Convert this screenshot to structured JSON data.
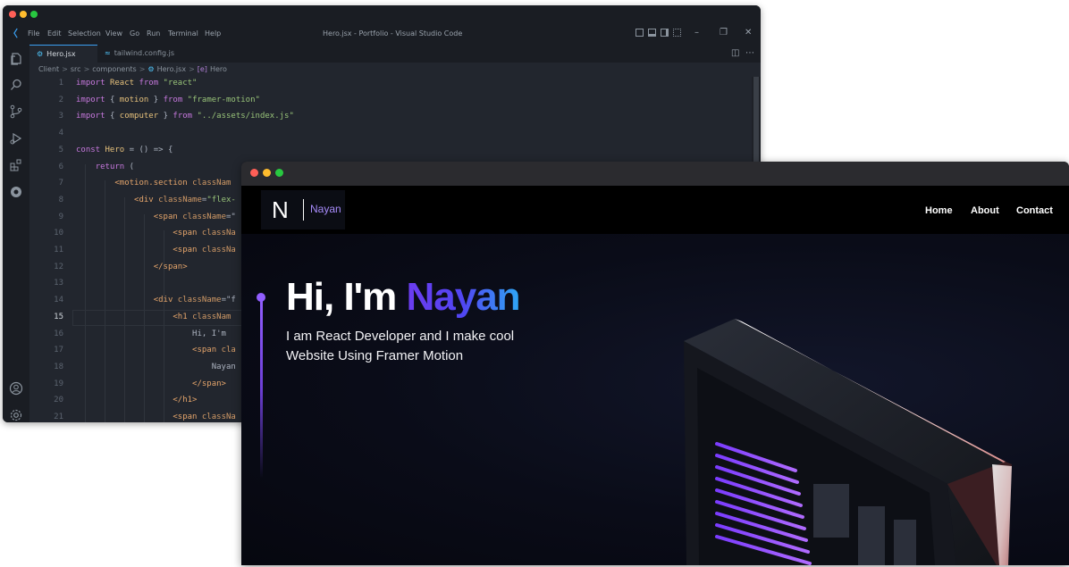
{
  "vscode": {
    "menu": [
      "File",
      "Edit",
      "Selection",
      "View",
      "Go",
      "Run",
      "Terminal",
      "Help"
    ],
    "window_title": "Hero.jsx - Portfolio - Visual Studio Code",
    "tabs": [
      {
        "label": "Hero.jsx",
        "active": true
      },
      {
        "label": "tailwind.config.js",
        "active": false
      }
    ],
    "breadcrumb": [
      "Client",
      "src",
      "components",
      "Hero.jsx",
      "Hero"
    ],
    "current_line": 15,
    "lines": [
      {
        "n": "1",
        "code": [
          [
            "kw",
            "import "
          ],
          [
            "var",
            "React "
          ],
          [
            "kw",
            "from "
          ],
          [
            "str",
            "\"react\""
          ]
        ]
      },
      {
        "n": "2",
        "code": [
          [
            "kw",
            "import "
          ],
          [
            "punc",
            "{ "
          ],
          [
            "var",
            "motion "
          ],
          [
            "punc",
            "} "
          ],
          [
            "kw",
            "from "
          ],
          [
            "str",
            "\"framer-motion\""
          ]
        ]
      },
      {
        "n": "3",
        "code": [
          [
            "kw",
            "import "
          ],
          [
            "punc",
            "{ "
          ],
          [
            "var",
            "computer "
          ],
          [
            "punc",
            "} "
          ],
          [
            "kw",
            "from "
          ],
          [
            "str",
            "\"../assets/index.js\""
          ]
        ]
      },
      {
        "n": "4",
        "code": []
      },
      {
        "n": "5",
        "code": [
          [
            "kw",
            "const "
          ],
          [
            "var",
            "Hero "
          ],
          [
            "punc",
            "= () => {"
          ]
        ]
      },
      {
        "n": "6",
        "code": [
          [
            "punc",
            "    "
          ],
          [
            "kw",
            "return "
          ],
          [
            "punc",
            "("
          ]
        ]
      },
      {
        "n": "7",
        "code": [
          [
            "punc",
            "        "
          ],
          [
            "tag",
            "<motion.section "
          ],
          [
            "attr",
            "classNam"
          ]
        ]
      },
      {
        "n": "8",
        "code": [
          [
            "punc",
            "            "
          ],
          [
            "tag",
            "<div "
          ],
          [
            "attr",
            "className"
          ],
          [
            "punc",
            "="
          ],
          [
            "str",
            "\"flex-"
          ]
        ]
      },
      {
        "n": "9",
        "code": [
          [
            "punc",
            "                "
          ],
          [
            "tag",
            "<span "
          ],
          [
            "attr",
            "className"
          ],
          [
            "punc",
            "=\""
          ]
        ]
      },
      {
        "n": "10",
        "code": [
          [
            "punc",
            "                    "
          ],
          [
            "tag",
            "<span "
          ],
          [
            "attr",
            "classNa"
          ]
        ]
      },
      {
        "n": "11",
        "code": [
          [
            "punc",
            "                    "
          ],
          [
            "tag",
            "<span "
          ],
          [
            "attr",
            "classNa"
          ]
        ]
      },
      {
        "n": "12",
        "code": [
          [
            "punc",
            "                "
          ],
          [
            "tag",
            "</span>"
          ]
        ]
      },
      {
        "n": "13",
        "code": []
      },
      {
        "n": "14",
        "code": [
          [
            "punc",
            "                "
          ],
          [
            "tag",
            "<div "
          ],
          [
            "attr",
            "className"
          ],
          [
            "punc",
            "=\"f"
          ]
        ]
      },
      {
        "n": "15",
        "code": [
          [
            "punc",
            "                    "
          ],
          [
            "tag",
            "<h1 "
          ],
          [
            "attr",
            "classNam"
          ]
        ]
      },
      {
        "n": "16",
        "code": [
          [
            "punc",
            "                        Hi, I'm"
          ]
        ]
      },
      {
        "n": "17",
        "code": [
          [
            "punc",
            "                        "
          ],
          [
            "tag",
            "<span "
          ],
          [
            "attr",
            "cla"
          ]
        ]
      },
      {
        "n": "18",
        "code": [
          [
            "punc",
            "                            Nayan"
          ]
        ]
      },
      {
        "n": "19",
        "code": [
          [
            "punc",
            "                        "
          ],
          [
            "tag",
            "</span>"
          ]
        ]
      },
      {
        "n": "20",
        "code": [
          [
            "punc",
            "                    "
          ],
          [
            "tag",
            "</h1>"
          ]
        ]
      },
      {
        "n": "21",
        "code": [
          [
            "punc",
            "                    "
          ],
          [
            "tag",
            "<span "
          ],
          [
            "attr",
            "classNa"
          ]
        ]
      }
    ]
  },
  "site": {
    "brand_letter": "N",
    "brand_name": "Nayan",
    "nav": [
      "Home",
      "About",
      "Contact"
    ],
    "hero_greeting": "Hi, I'm ",
    "hero_name": "Nayan",
    "hero_subtitle": "I am React Developer and I make cool Website Using Framer Motion"
  },
  "colors": {
    "accent": "#915eff",
    "editor_bg": "#22262e",
    "site_bg": "#070913"
  }
}
